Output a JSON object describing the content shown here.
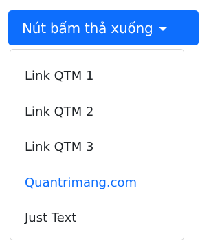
{
  "dropdown": {
    "button_label": "Nút bấm thả xuống",
    "caret_icon": "caret-down-icon",
    "items": [
      {
        "label": "Link QTM 1",
        "kind": "item"
      },
      {
        "label": "Link QTM 2",
        "kind": "item"
      },
      {
        "label": "Link QTM 3",
        "kind": "item"
      },
      {
        "label": "Quantrimang.com",
        "kind": "link"
      },
      {
        "label": "Just Text",
        "kind": "text"
      }
    ]
  },
  "colors": {
    "primary": "#0d6efd",
    "text": "#212529",
    "menu_border": "#d9d9d9"
  }
}
